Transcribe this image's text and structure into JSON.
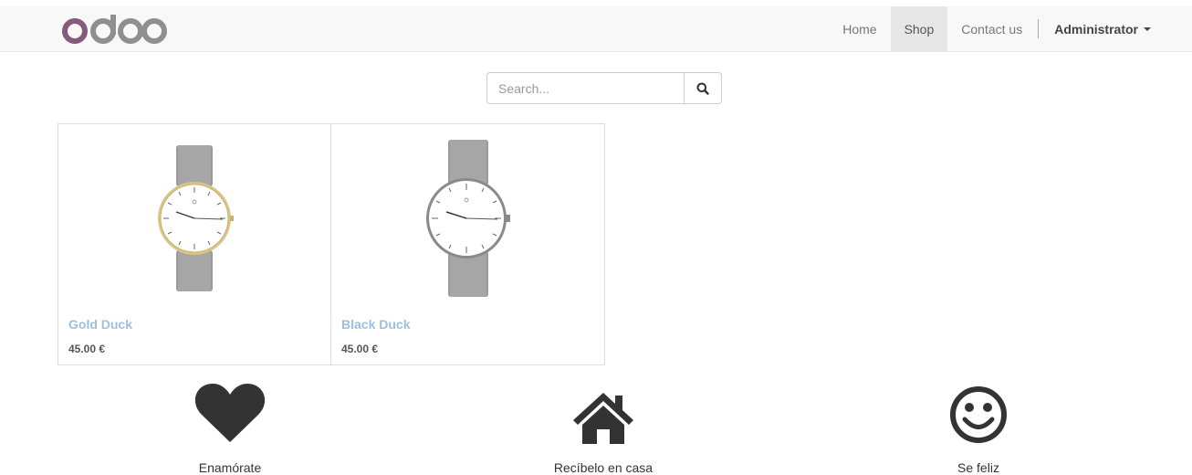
{
  "navbar": {
    "brand": "odoo",
    "brand_color": "#875a7b",
    "links": [
      {
        "label": "Home"
      },
      {
        "label": "Shop",
        "active": true
      },
      {
        "label": "Contact us"
      }
    ],
    "user": "Administrator"
  },
  "search": {
    "placeholder": "Search...",
    "icon": "search-icon"
  },
  "products": [
    {
      "name": "Gold Duck",
      "price": "45.00 €",
      "image": "gold-watch"
    },
    {
      "name": "Black Duck",
      "price": "45.00 €",
      "image": "silver-watch"
    }
  ],
  "features": [
    {
      "label": "Enamórate",
      "icon": "heart-icon"
    },
    {
      "label": "Recíbelo en casa",
      "icon": "home-icon"
    },
    {
      "label": "Se feliz",
      "icon": "smile-icon"
    }
  ],
  "colors": {
    "link": "#9dc0e0",
    "icon": "#333333",
    "nav_bg": "#f8f8f8"
  }
}
